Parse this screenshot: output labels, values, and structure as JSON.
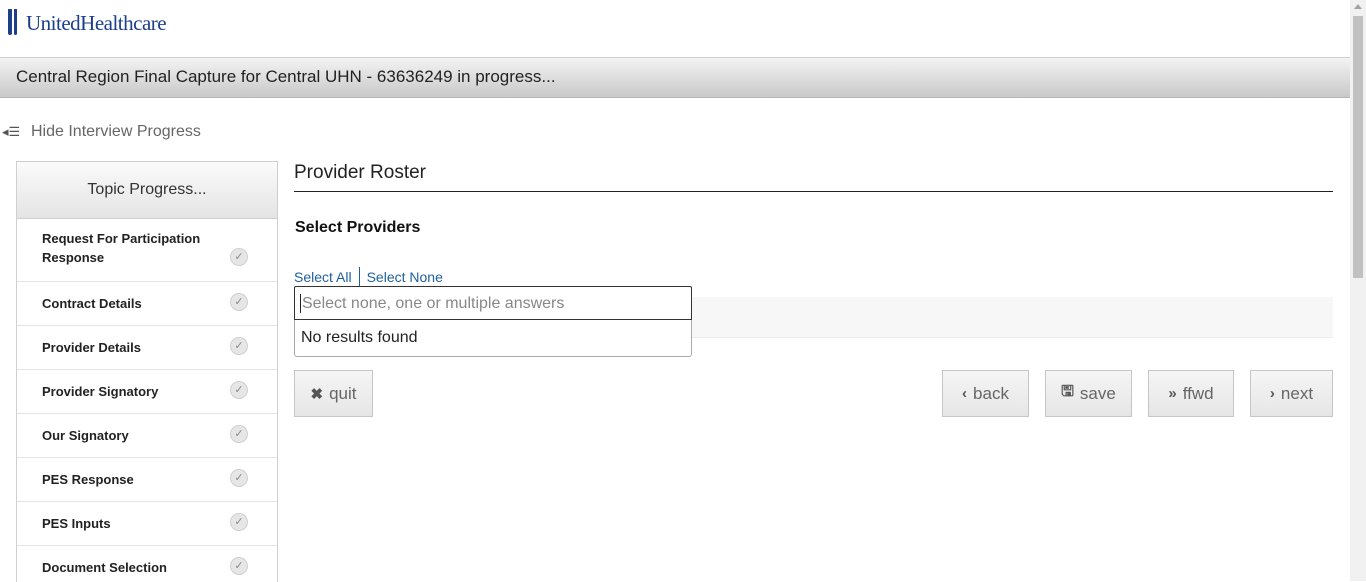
{
  "brand": {
    "logo_text": "UnitedHealthcare",
    "color": "#1b3f8b"
  },
  "title_band": {
    "text": "Central Region Final Capture for Central UHN - 63636249 in progress..."
  },
  "interview_toggle": {
    "label": "Hide Interview Progress",
    "icon": "collapse-list-icon"
  },
  "sidebar": {
    "header": "Topic Progress...",
    "items": [
      {
        "label": "Request For Participation Response",
        "icon": "check-icon"
      },
      {
        "label": "Contract Details",
        "icon": "check-icon"
      },
      {
        "label": "Provider Details",
        "icon": "check-icon"
      },
      {
        "label": "Provider Signatory",
        "icon": "check-icon"
      },
      {
        "label": "Our Signatory",
        "icon": "check-icon"
      },
      {
        "label": "PES Response",
        "icon": "check-icon"
      },
      {
        "label": "PES Inputs",
        "icon": "check-icon"
      },
      {
        "label": "Document Selection",
        "icon": "check-icon"
      }
    ]
  },
  "main": {
    "title": "Provider Roster",
    "section_label": "Select Providers",
    "select_all": "Select All",
    "select_none": "Select None",
    "search": {
      "placeholder": "Select none, one or multiple answers",
      "value": ""
    },
    "no_results": "No results found",
    "link_color": "#1f5f9e"
  },
  "buttons": {
    "quit": "quit",
    "back": "back",
    "save": "save",
    "ffwd": "ffwd",
    "next": "next"
  }
}
